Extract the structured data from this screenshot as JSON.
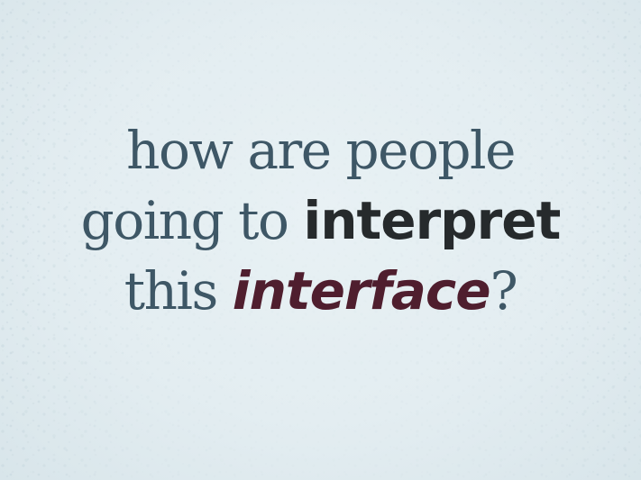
{
  "slide": {
    "line1": "how are people",
    "line2_plain": "going to ",
    "line2_emphasis": "interpret",
    "line3_plain": "this ",
    "line3_emphasis": "interface",
    "line3_end": "?"
  },
  "colors": {
    "background": "#e3edf1",
    "text": "#3e5766",
    "emphasis_dark": "#262a2c",
    "emphasis_maroon": "#4f1e2e"
  }
}
